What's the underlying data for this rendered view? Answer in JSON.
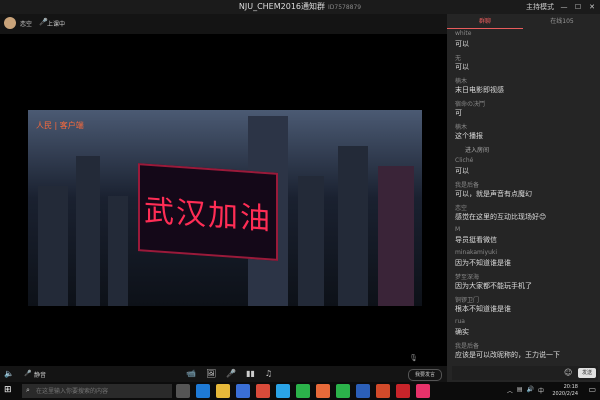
{
  "window": {
    "title": "NJU_CHEM2016通知群",
    "room_id": "ID7578879",
    "moderator_label": "主持模式",
    "controls": [
      "—",
      "☐",
      "✕"
    ]
  },
  "host": {
    "name": "恋空",
    "mic_status": "上课中"
  },
  "video": {
    "watermark": "人民 | 客户端",
    "sign_text": "武汉加油"
  },
  "controls": {
    "speaker_icon": "speaker-icon",
    "mic_label": "静音",
    "tools": [
      "video-camera-icon",
      "image-icon",
      "microphone-icon",
      "bars-icon",
      "music-icon"
    ],
    "apply_label": "我要发言"
  },
  "chat": {
    "tabs": [
      {
        "label": "群聊"
      },
      {
        "label": "在线105"
      }
    ],
    "messages": [
      {
        "name": "white",
        "text": "可以"
      },
      {
        "name": "无",
        "text": "可以"
      },
      {
        "name": "楠木",
        "text": "末日电影即视感"
      },
      {
        "name": "宿命の决鬥",
        "text": "可"
      },
      {
        "name": "楠木",
        "text": "这个播报"
      }
    ],
    "system_line": "进入房间",
    "messages2": [
      {
        "name": "Cliché",
        "text": "可以"
      },
      {
        "name": "我是后备",
        "text": "可以，就是声音有点魔幻"
      },
      {
        "name": "恋空",
        "text": "感觉在这里的互动比现场好😊"
      },
      {
        "name": "M",
        "text": "导员挺看微信"
      },
      {
        "name": "minakamiyuki",
        "text": "因为不知道谁是谁"
      },
      {
        "name": "梦至深海",
        "text": "因为大家都不能玩手机了"
      },
      {
        "name": "铜锣卫门",
        "text": "根本不知道谁是谁"
      },
      {
        "name": "rua",
        "text": "确实"
      },
      {
        "name": "我是后备",
        "text": "应该是可以改昵称的，王力说一下"
      }
    ],
    "send_label": "发送"
  },
  "taskbar": {
    "search_placeholder": "在这里输入你要搜索的内容",
    "apps": [
      {
        "name": "task-view-icon",
        "color": "#555555"
      },
      {
        "name": "edge-icon",
        "color": "#1e7ad6"
      },
      {
        "name": "explorer-icon",
        "color": "#e8b93a"
      },
      {
        "name": "store-icon",
        "color": "#3a6fd6"
      },
      {
        "name": "chrome-icon",
        "color": "#d94b3a"
      },
      {
        "name": "qq-icon",
        "color": "#2aa4e8"
      },
      {
        "name": "wechat-icon",
        "color": "#2bb34a"
      },
      {
        "name": "classroom-app-icon",
        "color": "#e86a3a"
      },
      {
        "name": "wechat-alt-icon",
        "color": "#2bb34a"
      },
      {
        "name": "word-icon",
        "color": "#2b5fb8"
      },
      {
        "name": "powerpoint-icon",
        "color": "#d24a2a"
      },
      {
        "name": "acrobat-icon",
        "color": "#c8242a"
      },
      {
        "name": "message-icon",
        "color": "#e8326a"
      }
    ],
    "time": "20:18",
    "date": "2020/2/24"
  }
}
